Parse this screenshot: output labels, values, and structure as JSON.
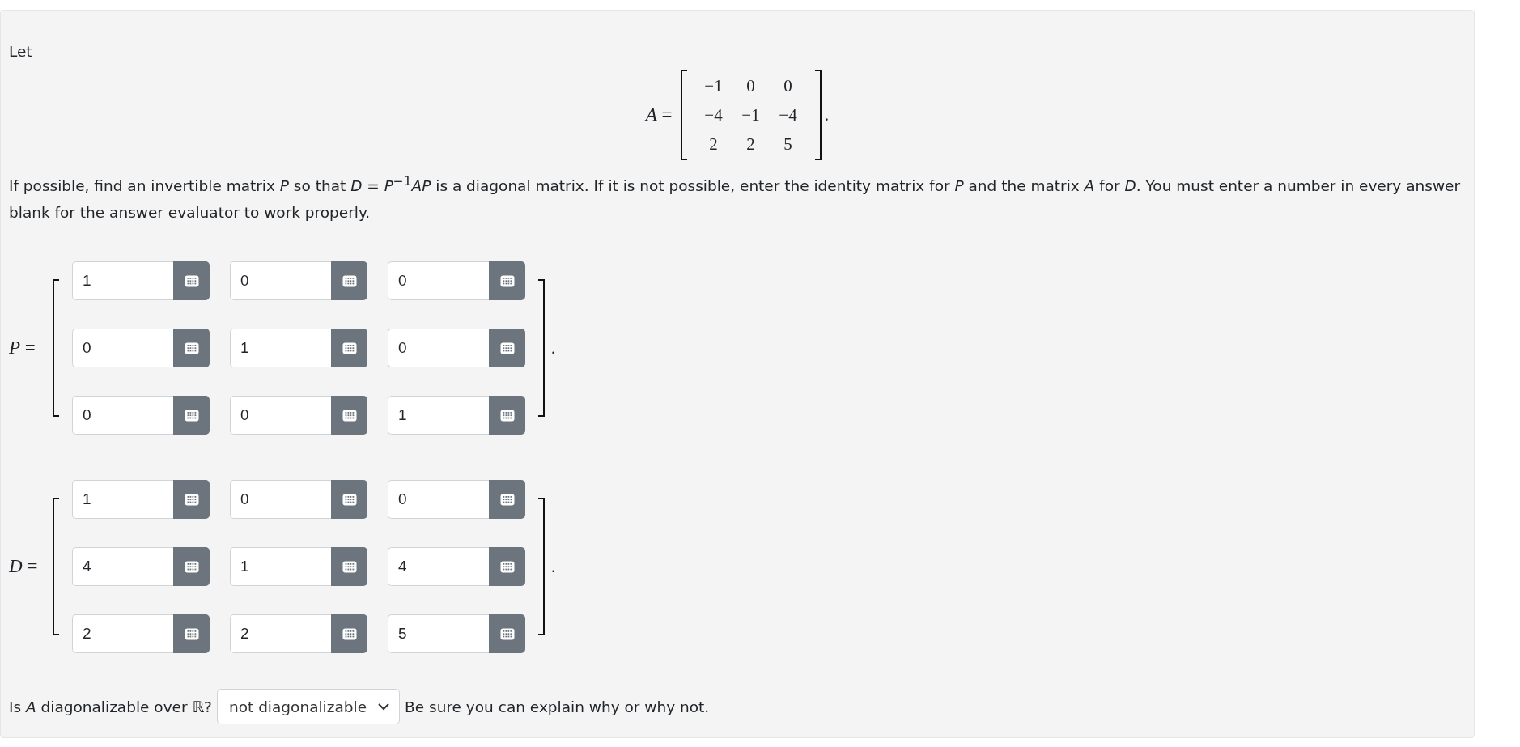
{
  "intro": "Let",
  "matrix_a": {
    "label": "*A* =",
    "rows": [
      [
        "−1",
        "0",
        "0"
      ],
      [
        "−4",
        "−1",
        "−4"
      ],
      [
        "2",
        "2",
        "5"
      ]
    ],
    "end": "."
  },
  "instructions": "If possible, find an invertible matrix *P* so that *D* = *P*$^{−1}$*AP* is a diagonal matrix. If it is not possible, enter the identity matrix for *P* and the matrix *A* for *D*. You must enter a number in every answer blank for the answer evaluator to work properly.",
  "answer_matrices": [
    {
      "label": "*P* =",
      "end": ".",
      "rows": [
        [
          "1",
          "0",
          "0"
        ],
        [
          "0",
          "1",
          "0"
        ],
        [
          "0",
          "0",
          "1"
        ]
      ]
    },
    {
      "label": "*D* =",
      "end": ".",
      "rows": [
        [
          "1",
          "0",
          "0"
        ],
        [
          "4",
          "1",
          "4"
        ],
        [
          "2",
          "2",
          "5"
        ]
      ]
    }
  ],
  "question": {
    "prompt": "Is *A* diagonalizable over ℝ?",
    "select": "not diagonalizable",
    "note": "Be sure you can explain why or why not."
  }
}
